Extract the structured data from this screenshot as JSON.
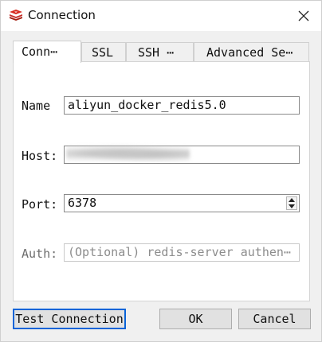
{
  "window": {
    "title": "Connection",
    "icon": "redis-logo-icon",
    "close_icon": "close-icon"
  },
  "tabs": [
    {
      "label": "Conn⋯",
      "active": true
    },
    {
      "label": "SSL",
      "active": false
    },
    {
      "label": "SSH ⋯",
      "active": false
    },
    {
      "label": "Advanced Se⋯",
      "active": false
    }
  ],
  "form": {
    "name": {
      "label": "Name",
      "value": "aliyun_docker_redis5.0"
    },
    "host": {
      "label": "Host:",
      "value": ""
    },
    "port": {
      "label": "Port:",
      "value": "6378"
    },
    "auth": {
      "label": "Auth:",
      "placeholder": "(Optional) redis-server authen⋯"
    }
  },
  "buttons": {
    "test_connection": "Test Connection",
    "ok": "OK",
    "cancel": "Cancel"
  },
  "colors": {
    "accent": "#0a64d8",
    "brand_red": "#d82c20"
  }
}
